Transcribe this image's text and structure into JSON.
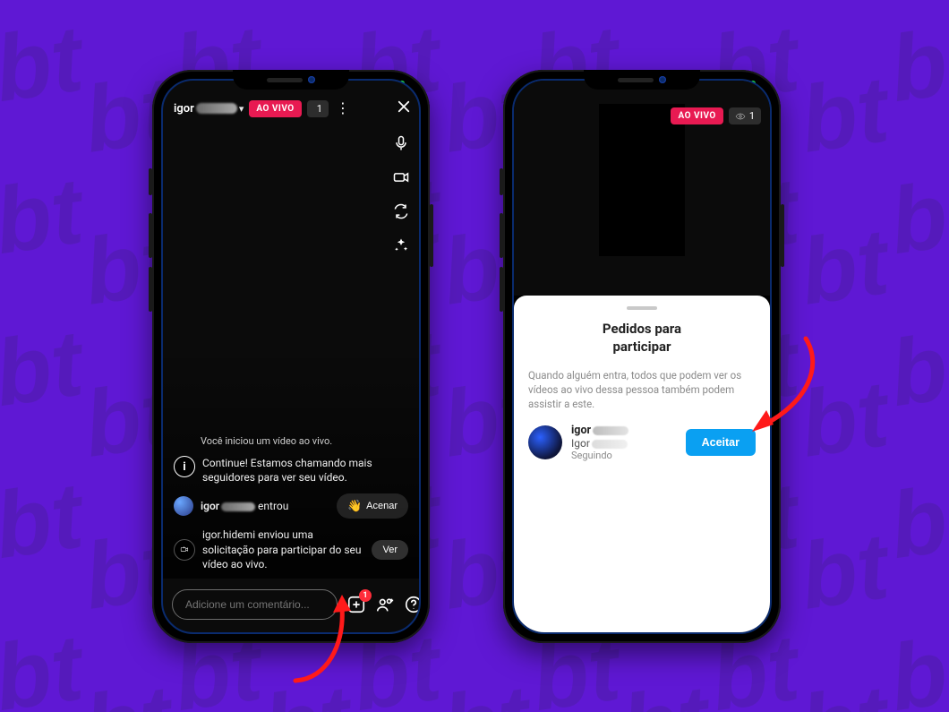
{
  "background": {
    "accent": "#5f18d4",
    "pattern_text": "bt"
  },
  "live_badge": "AO VIVO",
  "viewer_count": "1",
  "left": {
    "username_prefix": "igor",
    "system_started": "Você iniciou um vídeo ao vivo.",
    "continue_msg": "Continue! Estamos chamando mais seguidores para ver seu vídeo.",
    "join_user_prefix": "igor",
    "join_suffix": "entrou",
    "wave_label": "Acenar",
    "request_msg": "igor.hidemi enviou uma solicitação para participar do seu vídeo ao vivo.",
    "ver_label": "Ver",
    "comment_placeholder": "Adicione um comentário...",
    "request_badge": "1"
  },
  "right": {
    "sheet_title": "Pedidos para participar",
    "hint": "Quando alguém entra, todos que podem ver os vídeos ao vivo dessa pessoa também podem assistir a este.",
    "req_name_prefix": "igor",
    "req_display_prefix": "Igor",
    "following": "Seguindo",
    "accept_label": "Aceitar"
  }
}
